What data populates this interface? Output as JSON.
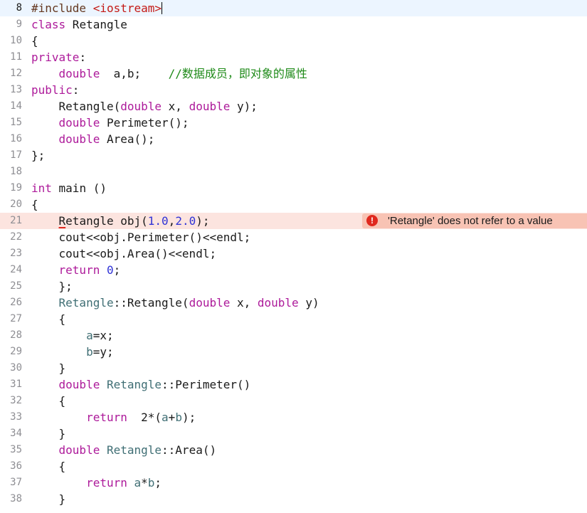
{
  "editor": {
    "lines": [
      {
        "n": "8",
        "tokens": [
          [
            "#include ",
            "pp"
          ],
          [
            "<iostream>",
            "str"
          ]
        ],
        "caret": true
      },
      {
        "n": "9",
        "tokens": [
          [
            "class",
            "kw"
          ],
          [
            " Retangle",
            ""
          ]
        ]
      },
      {
        "n": "10",
        "tokens": [
          [
            "{",
            ""
          ]
        ]
      },
      {
        "n": "11",
        "tokens": [
          [
            "private",
            "kw"
          ],
          [
            ":",
            ""
          ]
        ]
      },
      {
        "n": "12",
        "tokens": [
          [
            "    ",
            ""
          ],
          [
            "double",
            "kw"
          ],
          [
            "  a,b;    ",
            ""
          ],
          [
            "//数据成员，即对象的属性",
            "cm"
          ]
        ]
      },
      {
        "n": "13",
        "tokens": [
          [
            "public",
            "kw"
          ],
          [
            ":",
            ""
          ]
        ]
      },
      {
        "n": "14",
        "tokens": [
          [
            "    Retangle(",
            ""
          ],
          [
            "double",
            "kw"
          ],
          [
            " x, ",
            ""
          ],
          [
            "double",
            "kw"
          ],
          [
            " y);",
            ""
          ]
        ]
      },
      {
        "n": "15",
        "tokens": [
          [
            "    ",
            ""
          ],
          [
            "double",
            "kw"
          ],
          [
            " Perimeter();",
            ""
          ]
        ]
      },
      {
        "n": "16",
        "tokens": [
          [
            "    ",
            ""
          ],
          [
            "double",
            "kw"
          ],
          [
            " Area();",
            ""
          ]
        ]
      },
      {
        "n": "17",
        "tokens": [
          [
            "};",
            ""
          ]
        ]
      },
      {
        "n": "18",
        "tokens": []
      },
      {
        "n": "19",
        "tokens": [
          [
            "int",
            "kw"
          ],
          [
            " main ()",
            ""
          ]
        ]
      },
      {
        "n": "20",
        "tokens": [
          [
            "{",
            ""
          ]
        ]
      },
      {
        "n": "21",
        "tokens": [
          [
            "    ",
            ""
          ],
          [
            "R",
            "errU"
          ],
          [
            "etangle obj(",
            ""
          ],
          [
            "1.0",
            "num"
          ],
          [
            ",",
            ""
          ],
          [
            "2.0",
            "num"
          ],
          [
            ");",
            ""
          ]
        ],
        "error": true
      },
      {
        "n": "22",
        "tokens": [
          [
            "    cout<<obj.Perimeter()<<endl;",
            ""
          ]
        ]
      },
      {
        "n": "23",
        "tokens": [
          [
            "    cout<<obj.Area()<<endl;",
            ""
          ]
        ]
      },
      {
        "n": "24",
        "tokens": [
          [
            "    ",
            ""
          ],
          [
            "return",
            "kw"
          ],
          [
            " ",
            ""
          ],
          [
            "0",
            "num"
          ],
          [
            ";",
            ""
          ]
        ]
      },
      {
        "n": "25",
        "tokens": [
          [
            "    };",
            ""
          ]
        ]
      },
      {
        "n": "26",
        "tokens": [
          [
            "    ",
            ""
          ],
          [
            "Retangle",
            "tp"
          ],
          [
            "::Retangle(",
            ""
          ],
          [
            "double",
            "kw"
          ],
          [
            " x, ",
            ""
          ],
          [
            "double",
            "kw"
          ],
          [
            " y)",
            ""
          ]
        ]
      },
      {
        "n": "27",
        "tokens": [
          [
            "    {",
            ""
          ]
        ]
      },
      {
        "n": "28",
        "tokens": [
          [
            "        ",
            ""
          ],
          [
            "a",
            "tp"
          ],
          [
            "=x;",
            ""
          ]
        ]
      },
      {
        "n": "29",
        "tokens": [
          [
            "        ",
            ""
          ],
          [
            "b",
            "tp"
          ],
          [
            "=y;",
            ""
          ]
        ]
      },
      {
        "n": "30",
        "tokens": [
          [
            "    }",
            ""
          ]
        ]
      },
      {
        "n": "31",
        "tokens": [
          [
            "    ",
            ""
          ],
          [
            "double",
            "kw"
          ],
          [
            " ",
            ""
          ],
          [
            "Retangle",
            "tp"
          ],
          [
            "::Perimeter()",
            ""
          ]
        ]
      },
      {
        "n": "32",
        "tokens": [
          [
            "    {",
            ""
          ]
        ]
      },
      {
        "n": "33",
        "tokens": [
          [
            "        ",
            ""
          ],
          [
            "return",
            "kw"
          ],
          [
            "  2*(",
            ""
          ],
          [
            "a",
            "tp"
          ],
          [
            "+",
            ""
          ],
          [
            "b",
            "tp"
          ],
          [
            ");",
            ""
          ]
        ]
      },
      {
        "n": "34",
        "tokens": [
          [
            "    }",
            ""
          ]
        ]
      },
      {
        "n": "35",
        "tokens": [
          [
            "    ",
            ""
          ],
          [
            "double",
            "kw"
          ],
          [
            " ",
            ""
          ],
          [
            "Retangle",
            "tp"
          ],
          [
            "::Area()",
            ""
          ]
        ]
      },
      {
        "n": "36",
        "tokens": [
          [
            "    {",
            ""
          ]
        ]
      },
      {
        "n": "37",
        "tokens": [
          [
            "        ",
            ""
          ],
          [
            "return",
            "kw"
          ],
          [
            " ",
            ""
          ],
          [
            "a",
            "tp"
          ],
          [
            "*",
            ""
          ],
          [
            "b",
            "tp"
          ],
          [
            ";",
            ""
          ]
        ]
      },
      {
        "n": "38",
        "tokens": [
          [
            "    }",
            ""
          ]
        ]
      }
    ]
  },
  "diagnostic": {
    "line": "21",
    "icon": "error-icon",
    "icon_glyph": "!",
    "message": "'Retangle' does not refer to a value"
  },
  "colors": {
    "keyword": "#ad1a9a",
    "number": "#2f32d6",
    "string": "#c41a16",
    "preprocessor": "#643820",
    "comment": "#1e8a18",
    "type": "#3f6e74",
    "error": "#e0281e",
    "error_line_bg": "#fce4df",
    "diagnostic_bg": "#f8c3b4"
  }
}
